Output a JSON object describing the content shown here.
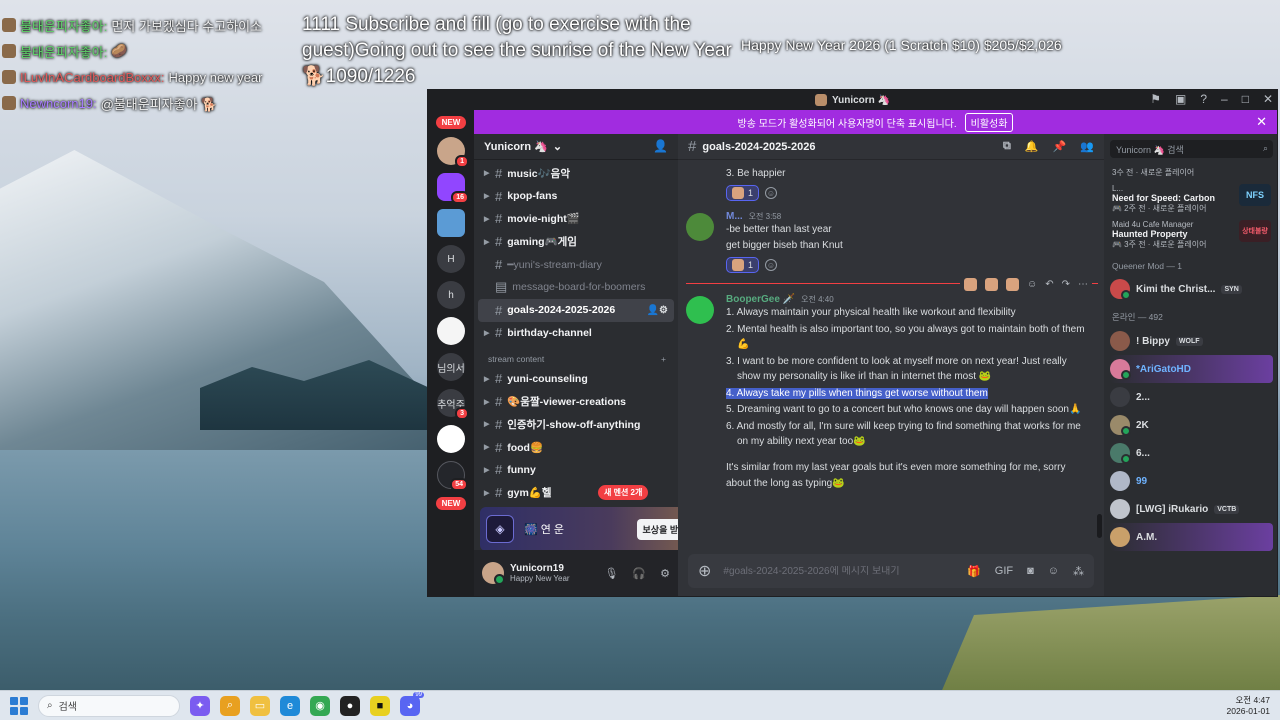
{
  "overlay": {
    "chat": [
      {
        "name": "불태운피자좋아:",
        "message": "먼저 가보겠심다 수고하이소",
        "color": "green"
      },
      {
        "name": "불태운피자좋아:",
        "message": "🥔",
        "color": "green"
      },
      {
        "name": "ILuvInACardboardBoxxx:",
        "message": "Happy new year",
        "color": "red"
      },
      {
        "name": "Newncorn19:",
        "message": "@불태운피자좋아 🐕",
        "color": "purple"
      }
    ],
    "goal_text": "1111 Subscribe and fill (go to exercise with the guest)Going out to see the sunrise of the New Year🐕1090/1226",
    "donation_text": "Happy New Year 2026 (1 Scratch $10) $205/$2,026"
  },
  "window": {
    "title": "Yunicorn 🦄",
    "controls": [
      "flag-icon",
      "screen-icon",
      "help-icon",
      "minimize-icon",
      "maximize-icon",
      "close-icon"
    ]
  },
  "banner": {
    "text": "방송 모드가 활성화되어 사용자명이 단축 표시됩니다.",
    "button": "비활성화",
    "close": "✕"
  },
  "servers": [
    {
      "label": "NEW",
      "kind": "new-pill"
    },
    {
      "label": "",
      "kind": "avatar1",
      "badge": "1"
    },
    {
      "label": "",
      "kind": "twitch",
      "badge": "16"
    },
    {
      "label": "",
      "kind": "yellow"
    },
    {
      "label": "H",
      "kind": ""
    },
    {
      "label": "h",
      "kind": ""
    },
    {
      "label": "",
      "kind": "white"
    },
    {
      "label": "님의서",
      "kind": ""
    },
    {
      "label": "추억주",
      "kind": "",
      "badge": "3"
    },
    {
      "label": "",
      "kind": "flag"
    },
    {
      "label": "",
      "kind": "dark",
      "badge": "54"
    },
    {
      "label": "NEW",
      "kind": "new-pill"
    }
  ],
  "server": {
    "name": "Yunicorn 🦄",
    "channels": [
      {
        "name": "music🎶음악",
        "muted": false,
        "arrow": true
      },
      {
        "name": "kpop-fans",
        "muted": false,
        "arrow": true
      },
      {
        "name": "movie-night🎬",
        "muted": false,
        "arrow": true
      },
      {
        "name": "gaming🎮게임",
        "muted": false,
        "arrow": true
      },
      {
        "name": "━yuni's-stream-diary",
        "muted": true,
        "arrow": false
      },
      {
        "name": "message-board-for-boomers",
        "muted": true,
        "arrow": false
      },
      {
        "name": "goals-2024-2025-2026",
        "muted": false,
        "arrow": false,
        "active": true
      },
      {
        "name": "birthday-channel",
        "muted": false,
        "arrow": true
      }
    ],
    "category": "stream content",
    "stream_channels": [
      {
        "name": "yuni-counseling"
      },
      {
        "name": "🎨움짤-viewer-creations"
      },
      {
        "name": "인증하기-show-off-anything"
      },
      {
        "name": "food🍔"
      },
      {
        "name": "funny"
      },
      {
        "name": "gym💪헬"
      }
    ],
    "new_messages_pill": "새 멘션 2개"
  },
  "promo": {
    "title": "🎆 연 운",
    "button": "보상을 받으세요!"
  },
  "user": {
    "name": "Yunicorn19",
    "status": "Happy New Year"
  },
  "chat": {
    "channel": "goals-2024-2025-2026",
    "first_line": "3. Be happier",
    "reaction_count_1": "1",
    "msg2": {
      "author": "M...",
      "time": "오전 3:58",
      "lines": [
        "-be better than last year",
        "get bigger biseb than Knut"
      ],
      "reaction_count": "1"
    },
    "msg3": {
      "author": "BooperGee 🗡️",
      "time": "오전 4:40",
      "goals": [
        "1. Always maintain your physical health like workout and flexibility",
        "2. Mental health is also important too, so you always got to maintain both of them💪",
        "3. I want to be more confident to look at myself more on next year! Just really show my personality is like irl than in internet the most 🐸",
        "4. Always take my pills when things get worse without them",
        "5. Dreaming want to go to a concert but who knows one day will happen soon🙏",
        "6. And mostly for all, I'm sure will keep trying to find something that works for me on my ability next year too🐸"
      ],
      "closing": "It's similar from my last year goals but it's even more something for me, sorry about the long as typing🐸"
    },
    "composer_placeholder": "#goals-2024-2025-2026에 메시지 보내기"
  },
  "members": {
    "search_placeholder": "Yunicorn 🦄 검색",
    "activities": [
      {
        "name": "3수 전 · 새로운 플레이어",
        "title": "",
        "sub": "",
        "thumb": ""
      },
      {
        "name": "L...",
        "title": "Need for Speed: Carbon",
        "sub": "🎮 2주 전 · 새로운 플레이어",
        "thumb": "NFS"
      },
      {
        "name": "Maid 4u Cafe Manager",
        "title": "Haunted Property",
        "sub": "🎮 3주 전 · 새로운 플레이어",
        "thumb": "상태불량"
      }
    ],
    "role_header": "Queener Mod — 1",
    "mod": {
      "name": "Kimi the Christ...",
      "tag": "SYN"
    },
    "online_header": "온라인 — 492",
    "online": [
      {
        "name": "! Bippy",
        "tag": "WOLF"
      },
      {
        "name": "*AriGatoHD",
        "tag": ""
      },
      {
        "name": "2...",
        "tag": ""
      },
      {
        "name": "2K",
        "tag": ""
      },
      {
        "name": "6...",
        "tag": ""
      },
      {
        "name": "99",
        "tag": ""
      },
      {
        "name": "[LWG] iRukario",
        "tag": "VCTB"
      },
      {
        "name": "A.M.",
        "tag": ""
      }
    ]
  },
  "taskbar": {
    "search_placeholder": "검색",
    "time": "오전 4:47",
    "date": "2026-01-01",
    "discord_badge": "99"
  }
}
